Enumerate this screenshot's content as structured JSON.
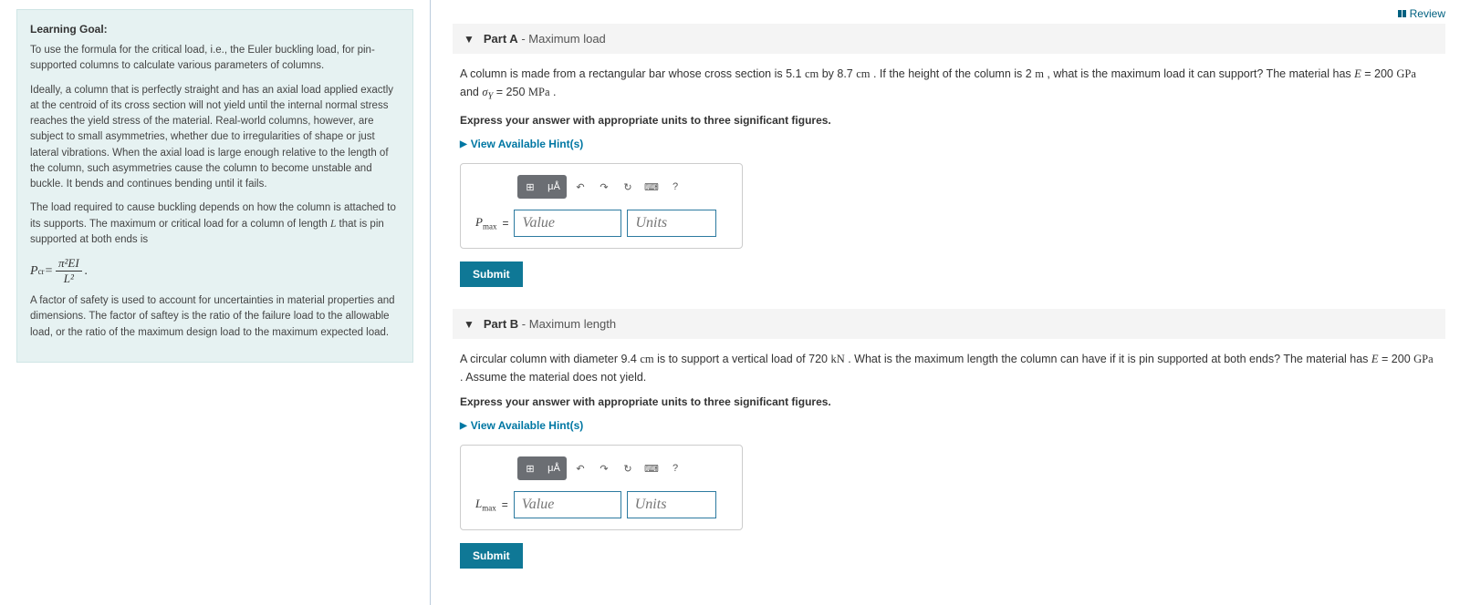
{
  "learning_goal": {
    "heading": "Learning Goal:",
    "p1": "To use the formula for the critical load, i.e., the Euler buckling load, for pin-supported columns to calculate various parameters of columns.",
    "p2": "Ideally, a column that is perfectly straight and has an axial load applied exactly at the centroid of its cross section will not yield until the internal normal stress reaches the yield stress of the material. Real-world columns, however, are subject to small asymmetries, whether due to irregularities of shape or just lateral vibrations. When the axial load is large enough relative to the length of the column, such asymmetries cause the column to become unstable and buckle. It bends and continues bending until it fails.",
    "p3_pre": "The load required to cause buckling depends on how the column is attached to its supports. The maximum or critical load for a column of length ",
    "p3_L": "L",
    "p3_post": " that is pin supported at both ends is",
    "formula_lhs": "P",
    "formula_sub": "cr",
    "formula_eq": " = ",
    "formula_num": "π²EI",
    "formula_den": "L²",
    "p4": "A factor of safety is used to account for uncertainties in material properties and dimensions. The factor of saftey is the ratio of the failure load to the allowable load, or the ratio of the maximum design load to the maximum expected load."
  },
  "review_label": "Review",
  "partA": {
    "title_bold": "Part A",
    "title_rest": " - Maximum load",
    "q1": "A column is made from a rectangular bar whose cross section is 5.1 ",
    "u_cm1": "cm",
    "q2": " by 8.7 ",
    "u_cm2": "cm",
    "q3": " . If the height of the column is 2 ",
    "u_m": "m",
    "q4": " , what is the maximum load it can support? The material has ",
    "E": "E",
    "q5": " = 200 ",
    "u_gpa": "GPa",
    "q6": " and ",
    "sigma": "σ",
    "sigma_sub": "Y",
    "q7": " = 250 ",
    "u_mpa": "MPa",
    "q8": " .",
    "instruction": "Express your answer with appropriate units to three significant figures.",
    "hints": "View Available Hint(s)",
    "var": "P",
    "var_sub": "max",
    "eq": " = ",
    "value_ph": "Value",
    "units_ph": "Units",
    "submit": "Submit"
  },
  "partB": {
    "title_bold": "Part B",
    "title_rest": " - Maximum length",
    "q1": "A circular column with diameter 9.4 ",
    "u_cm": "cm",
    "q2": " is to support a vertical load of 720 ",
    "u_kn": "kN",
    "q3": " . What is the maximum length the column can have if it is pin supported at both ends? The material has ",
    "E": "E",
    "q4": " = 200 ",
    "u_gpa": "GPa",
    "q5": " . Assume the material does not yield.",
    "instruction": "Express your answer with appropriate units to three significant figures.",
    "hints": "View Available Hint(s)",
    "var": "L",
    "var_sub": "max",
    "eq": " = ",
    "value_ph": "Value",
    "units_ph": "Units",
    "submit": "Submit"
  },
  "toolbar": {
    "templates": "⊞",
    "units_btn": "μÅ",
    "undo": "↶",
    "redo": "↷",
    "reset": "↻",
    "keyboard": "⌨",
    "help": "?"
  }
}
